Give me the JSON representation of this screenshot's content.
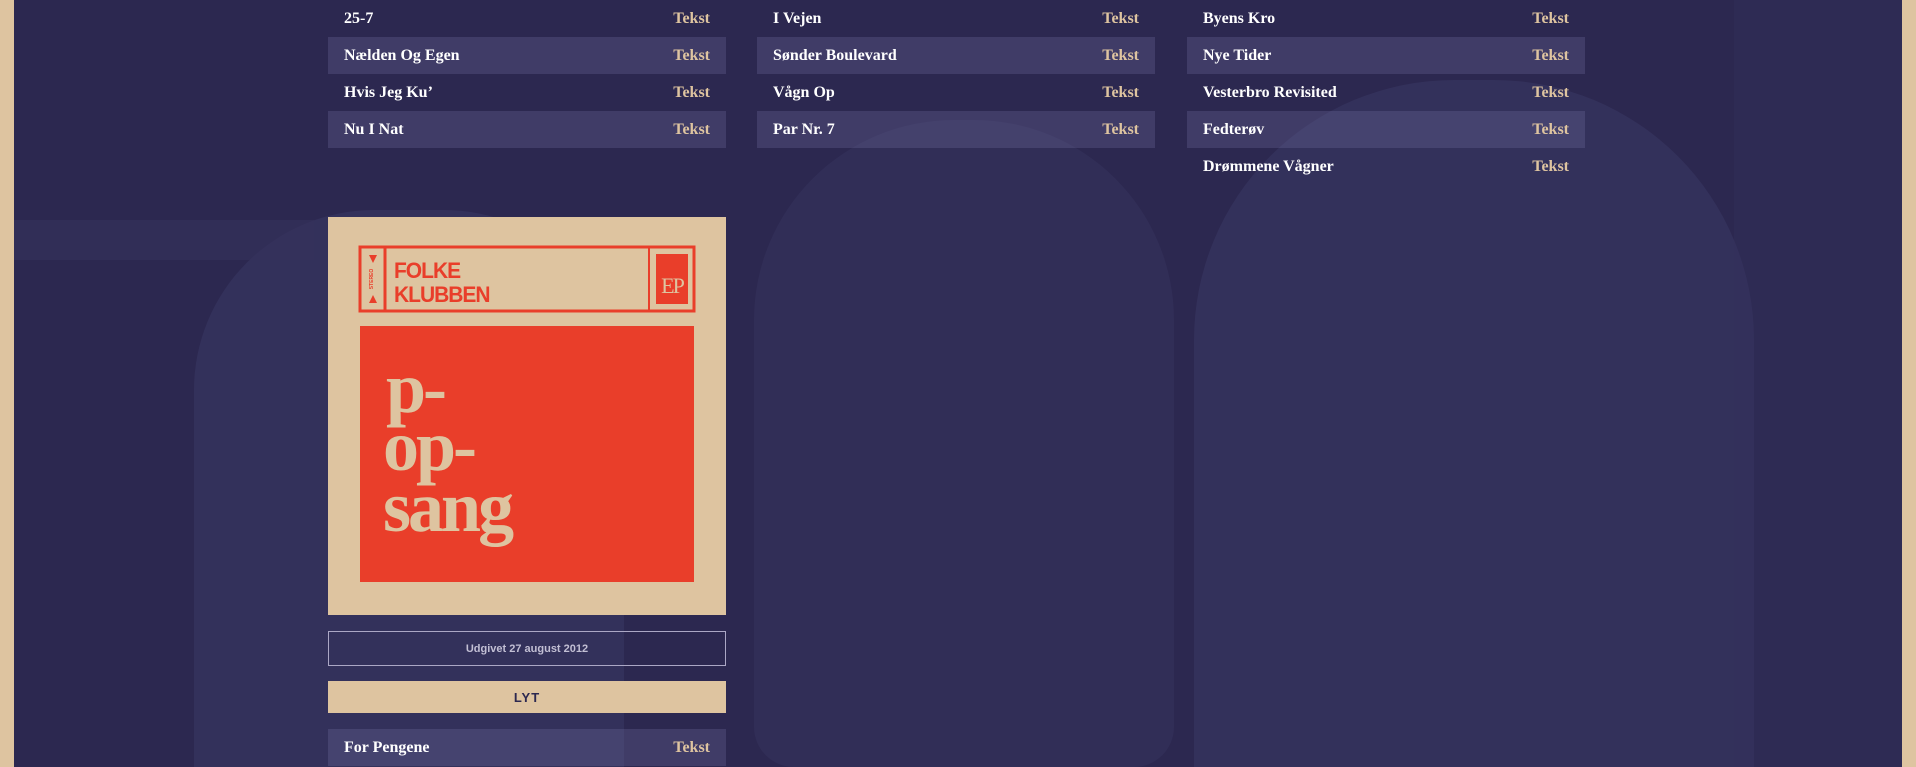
{
  "colors": {
    "accent": "#dec4a0",
    "background": "#2c2850",
    "cover_red": "#e93e2a",
    "row_shade": "#46436b"
  },
  "columns": [
    {
      "tracks": [
        {
          "title": "25-7",
          "link": "Tekst"
        },
        {
          "title": "Nælden Og Egen",
          "link": "Tekst"
        },
        {
          "title": "Hvis Jeg Ku’",
          "link": "Tekst"
        },
        {
          "title": "Nu I Nat",
          "link": "Tekst"
        }
      ]
    },
    {
      "tracks": [
        {
          "title": "I Vejen",
          "link": "Tekst"
        },
        {
          "title": "Sønder Boulevard",
          "link": "Tekst"
        },
        {
          "title": "Vågn Op",
          "link": "Tekst"
        },
        {
          "title": "Par Nr. 7",
          "link": "Tekst"
        }
      ]
    },
    {
      "tracks": [
        {
          "title": "Byens Kro",
          "link": "Tekst"
        },
        {
          "title": "Nye Tider",
          "link": "Tekst"
        },
        {
          "title": "Vesterbro Revisited",
          "link": "Tekst"
        },
        {
          "title": "Fedterøv",
          "link": "Tekst"
        },
        {
          "title": "Drømmene Vågner",
          "link": "Tekst"
        }
      ]
    }
  ],
  "album": {
    "cover": {
      "band_line1": "FOLKE",
      "band_line2": "KLUBBEN",
      "badge": "EP",
      "side_label": "STEREO",
      "title_line1": "p-",
      "title_line2": "op-",
      "title_line3": "sang"
    },
    "release_text": "Udgivet 27 august 2012",
    "listen_label": "LYT",
    "tracks": [
      {
        "title": "For Pengene",
        "link": "Tekst"
      }
    ]
  }
}
